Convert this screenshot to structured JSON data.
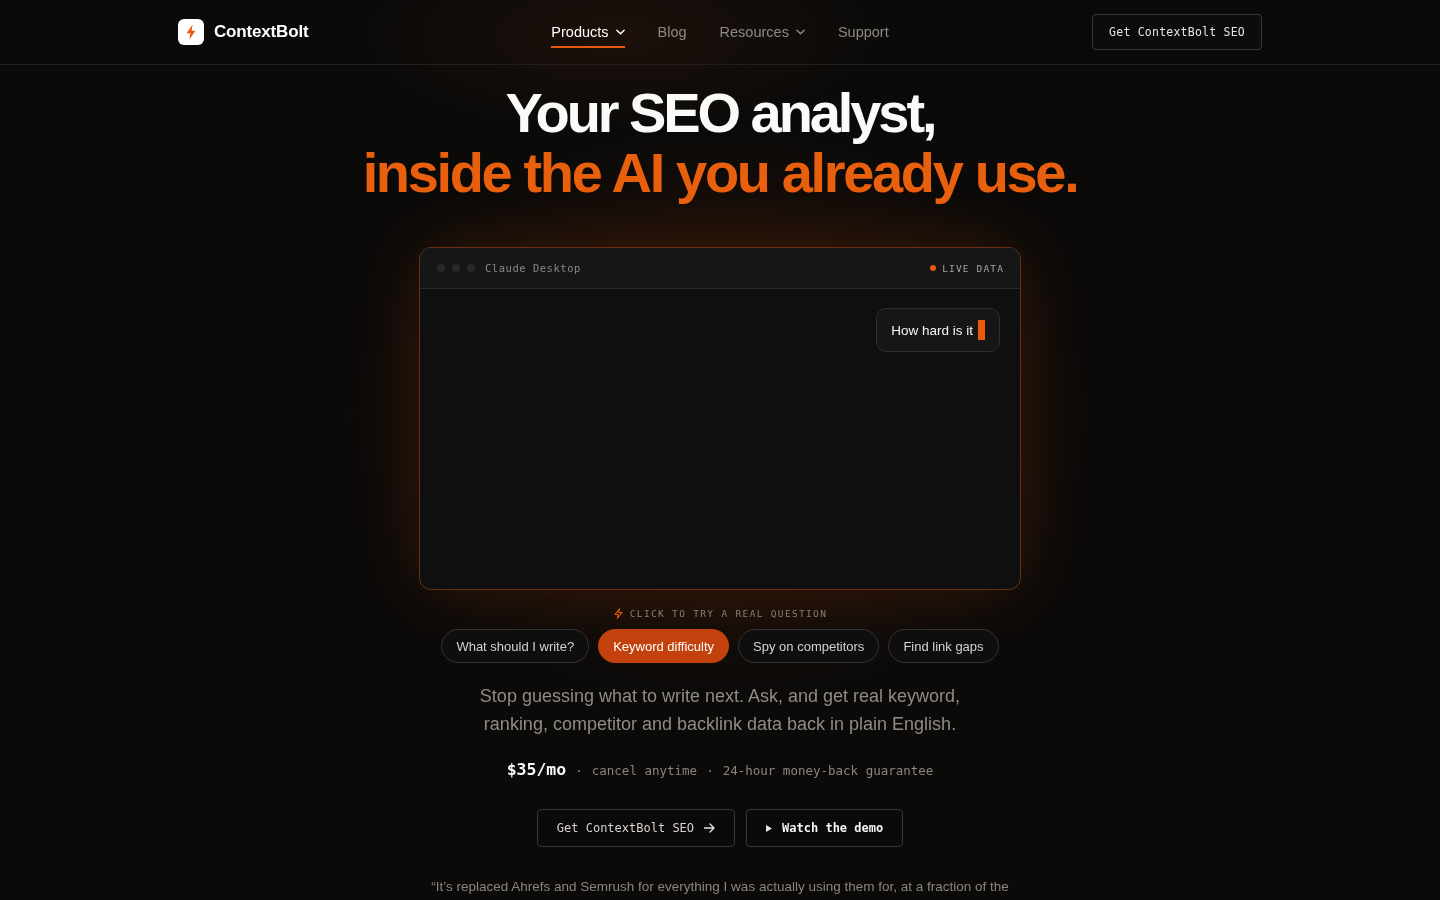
{
  "header": {
    "brand": "ContextBolt",
    "nav": [
      {
        "label": "Products",
        "selected": true,
        "dropdown": true
      },
      {
        "label": "Blog",
        "selected": false,
        "dropdown": false
      },
      {
        "label": "Resources",
        "selected": false,
        "dropdown": true
      },
      {
        "label": "Support",
        "selected": false,
        "dropdown": false
      }
    ],
    "cta": "Get ContextBolt SEO"
  },
  "hero": {
    "title_line_1": "Your SEO analyst,",
    "title_line_2": "inside the AI you already use."
  },
  "demo_window": {
    "title": "Claude Desktop",
    "status": "LIVE DATA",
    "messages": [
      {
        "text": "How hard is it",
        "typing": true
      }
    ]
  },
  "prompt_hint": "CLICK TO TRY A REAL QUESTION",
  "prompts": [
    {
      "label": "What should I write?",
      "selected": false
    },
    {
      "label": "Keyword difficulty",
      "selected": true
    },
    {
      "label": "Spy on competitors",
      "selected": false
    },
    {
      "label": "Find link gaps",
      "selected": false
    }
  ],
  "description": "Stop guessing what to write next. Ask, and get real keyword, ranking, competitor and backlink data back in plain English.",
  "pricing": {
    "price": "$35/mo",
    "separator": "·",
    "notes": [
      "cancel anytime",
      "24-hour money-back guarantee"
    ]
  },
  "actions": [
    {
      "label": "Get ContextBolt SEO",
      "kind": "primary"
    },
    {
      "label": "Watch the demo",
      "kind": "demo"
    }
  ],
  "testimonial": "“It’s replaced Ahrefs and Semrush for everything I was actually using them for, at a fraction of the"
}
